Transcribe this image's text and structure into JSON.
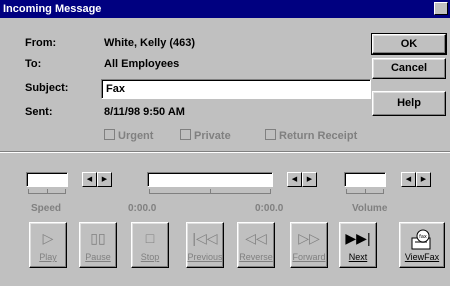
{
  "window": {
    "title": "Incoming Message"
  },
  "header": {
    "from_label": "From:",
    "from_value": "White, Kelly (463)",
    "to_label": "To:",
    "to_value": "All Employees",
    "subject_label": "Subject:",
    "subject_value": "Fax",
    "sent_label": "Sent:",
    "sent_value": "8/11/98  9:50 AM"
  },
  "buttons": {
    "ok": "OK",
    "cancel": "Cancel",
    "help": "Help"
  },
  "options": {
    "urgent": "Urgent",
    "private": "Private",
    "return_receipt": "Return Receipt"
  },
  "playback": {
    "speed_label": "Speed",
    "position_start": "0:00.0",
    "position_end": "0:00.0",
    "volume_label": "Volume"
  },
  "media_buttons": [
    {
      "label": "Play",
      "icon": "play-icon",
      "enabled": false
    },
    {
      "label": "Pause",
      "icon": "pause-icon",
      "enabled": false
    },
    {
      "label": "Stop",
      "icon": "stop-icon",
      "enabled": false
    },
    {
      "label": "Previous",
      "icon": "previous-icon",
      "enabled": false
    },
    {
      "label": "Reverse",
      "icon": "reverse-icon",
      "enabled": false
    },
    {
      "label": "Forward",
      "icon": "forward-icon",
      "enabled": false
    },
    {
      "label": "Next",
      "icon": "next-icon",
      "enabled": true
    },
    {
      "label": "ViewFax",
      "icon": "fax-icon",
      "enabled": true
    }
  ]
}
